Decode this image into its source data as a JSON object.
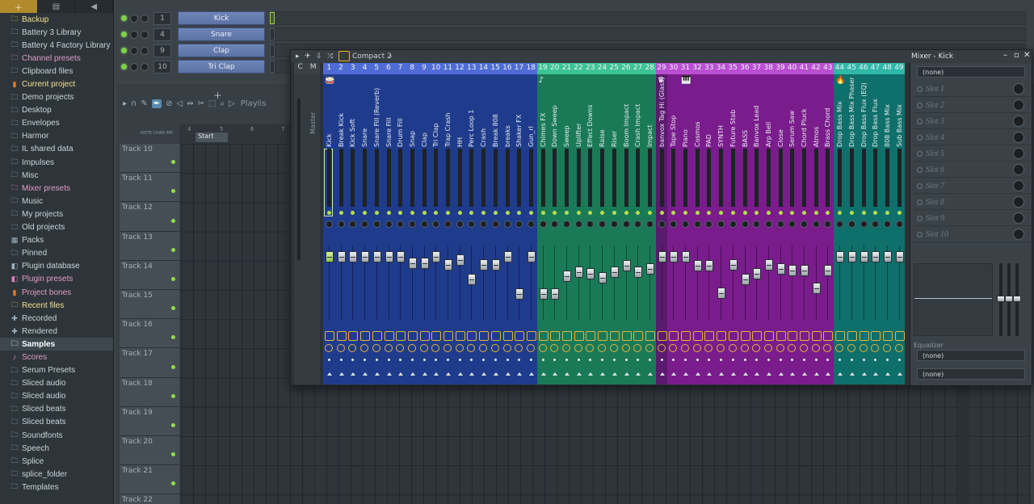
{
  "browser": {
    "tab_icons": [
      "add-icon",
      "file-icon",
      "speaker-icon"
    ],
    "items": [
      {
        "label": "Backup",
        "color": "yellow",
        "icon": "folder-icon"
      },
      {
        "label": "Battery 3 Library",
        "color": "normal",
        "icon": "folder-icon"
      },
      {
        "label": "Battery 4 Factory Library",
        "color": "normal",
        "icon": "folder-icon"
      },
      {
        "label": "Channel presets",
        "color": "pink",
        "icon": "folder-icon"
      },
      {
        "label": "Clipboard files",
        "color": "normal",
        "icon": "folder-icon"
      },
      {
        "label": "Current project",
        "color": "yellow",
        "icon": "project-icon"
      },
      {
        "label": "Demo projects",
        "color": "normal",
        "icon": "folder-icon"
      },
      {
        "label": "Desktop",
        "color": "normal",
        "icon": "folder-icon"
      },
      {
        "label": "Envelopes",
        "color": "normal",
        "icon": "folder-icon"
      },
      {
        "label": "Harmor",
        "color": "normal",
        "icon": "folder-icon"
      },
      {
        "label": "IL shared data",
        "color": "normal",
        "icon": "folder-icon"
      },
      {
        "label": "Impulses",
        "color": "normal",
        "icon": "folder-icon"
      },
      {
        "label": "Misc",
        "color": "normal",
        "icon": "folder-icon"
      },
      {
        "label": "Mixer presets",
        "color": "pink",
        "icon": "folder-icon"
      },
      {
        "label": "Music",
        "color": "normal",
        "icon": "folder-icon"
      },
      {
        "label": "My projects",
        "color": "normal",
        "icon": "folder-icon"
      },
      {
        "label": "Old projects",
        "color": "normal",
        "icon": "folder-icon"
      },
      {
        "label": "Packs",
        "color": "normal",
        "icon": "packs-icon"
      },
      {
        "label": "Pinned",
        "color": "normal",
        "icon": "folder-icon"
      },
      {
        "label": "Plugin database",
        "color": "normal",
        "icon": "plugin-icon"
      },
      {
        "label": "Plugin presets",
        "color": "pink",
        "icon": "plugin-icon"
      },
      {
        "label": "Project bones",
        "color": "pink",
        "icon": "project-icon"
      },
      {
        "label": "Recent files",
        "color": "yellow",
        "icon": "folder-icon"
      },
      {
        "label": "Recorded",
        "color": "normal",
        "icon": "plus-icon"
      },
      {
        "label": "Rendered",
        "color": "normal",
        "icon": "plus-icon"
      },
      {
        "label": "Samples",
        "color": "selected",
        "icon": "folder-icon"
      },
      {
        "label": "Scores",
        "color": "pink",
        "icon": "note-icon"
      },
      {
        "label": "Serum Presets",
        "color": "normal",
        "icon": "folder-icon"
      },
      {
        "label": "Sliced audio",
        "color": "normal",
        "icon": "folder-icon"
      },
      {
        "label": "Sliced audio",
        "color": "normal",
        "icon": "folder-icon"
      },
      {
        "label": "Sliced beats",
        "color": "normal",
        "icon": "folder-icon"
      },
      {
        "label": "Sliced beats",
        "color": "normal",
        "icon": "folder-icon"
      },
      {
        "label": "Soundfonts",
        "color": "normal",
        "icon": "folder-icon"
      },
      {
        "label": "Speech",
        "color": "normal",
        "icon": "folder-icon"
      },
      {
        "label": "Splice",
        "color": "normal",
        "icon": "folder-icon"
      },
      {
        "label": "splice_folder",
        "color": "normal",
        "icon": "folder-icon"
      },
      {
        "label": "Templates",
        "color": "normal",
        "icon": "folder-icon"
      }
    ]
  },
  "channel_rack": {
    "channels": [
      {
        "num": "1",
        "name": "Kick"
      },
      {
        "num": "4",
        "name": "Snare"
      },
      {
        "num": "9",
        "name": "Clap"
      },
      {
        "num": "10",
        "name": "Tri Clap"
      }
    ]
  },
  "playlist": {
    "title": "Playlis",
    "ruler_ticks": [
      "4",
      "5",
      "6",
      "7"
    ],
    "start_marker": "Start",
    "mode_labels": [
      "NOTE",
      "CHAN",
      "PAT"
    ],
    "tracks": [
      "Track 10",
      "Track 11",
      "Track 12",
      "Track 13",
      "Track 14",
      "Track 15",
      "Track 16",
      "Track 17",
      "Track 18",
      "Track 19",
      "Track 20",
      "Track 21",
      "Track 22"
    ]
  },
  "mixer": {
    "preset_name": "Compact 2",
    "window_title": "Mixer - Kick",
    "master_header": [
      "C",
      "M"
    ],
    "master_label": "Master",
    "selected_insert": 1,
    "group_colors": {
      "blue": "#1f3b8c",
      "blue_bar": "#4f6cd6",
      "green": "#1a7a58",
      "green_bar": "#3cc495",
      "purple": "#5a1a6e",
      "magenta": "#7a1c8c",
      "purple_bar": "#b94fd0",
      "teal": "#0f6f6a",
      "teal_bar": "#2fb7a8"
    },
    "group_icons": [
      {
        "name": "drum-icon",
        "glyph": "🥁"
      },
      {
        "name": "note-icon",
        "glyph": "♪"
      },
      {
        "name": "crown-icon",
        "glyph": "♛"
      },
      {
        "name": "piano-icon",
        "glyph": "🎹"
      },
      {
        "name": "fire-icon",
        "glyph": "🔥"
      }
    ],
    "inserts": [
      {
        "num": "1",
        "name": "Kick",
        "group": "blue",
        "fader": 0.92
      },
      {
        "num": "2",
        "name": "Break Kick",
        "group": "blue",
        "fader": 0.92
      },
      {
        "num": "3",
        "name": "Kick Soft",
        "group": "blue",
        "fader": 0.92
      },
      {
        "num": "4",
        "name": "Snare",
        "group": "blue",
        "fader": 0.92
      },
      {
        "num": "5",
        "name": "Snare Fill (Reverb)",
        "group": "blue",
        "fader": 0.92
      },
      {
        "num": "6",
        "name": "Snare Fill",
        "group": "blue",
        "fader": 0.92
      },
      {
        "num": "7",
        "name": "Drum Fill",
        "group": "blue",
        "fader": 0.92
      },
      {
        "num": "8",
        "name": "Snap",
        "group": "blue",
        "fader": 0.84
      },
      {
        "num": "9",
        "name": "Clap",
        "group": "blue",
        "fader": 0.84
      },
      {
        "num": "10",
        "name": "Tri Clap",
        "group": "blue",
        "fader": 0.92
      },
      {
        "num": "11",
        "name": "Trap Crash",
        "group": "blue",
        "fader": 0.82
      },
      {
        "num": "12",
        "name": "HH",
        "group": "blue",
        "fader": 0.88
      },
      {
        "num": "13",
        "name": "Perc Loop 1",
        "group": "blue",
        "fader": 0.62
      },
      {
        "num": "14",
        "name": "Crash",
        "group": "blue",
        "fader": 0.82
      },
      {
        "num": "15",
        "name": "Break 808",
        "group": "blue",
        "fader": 0.82
      },
      {
        "num": "16",
        "name": "breaks",
        "group": "blue",
        "fader": 0.92
      },
      {
        "num": "17",
        "name": "Shaker FX",
        "group": "blue",
        "fader": 0.42
      },
      {
        "num": "18",
        "name": "Gun_rl",
        "group": "blue",
        "fader": 0.92
      },
      {
        "num": "19",
        "name": "Chimes FX",
        "group": "green",
        "fader": 0.42
      },
      {
        "num": "20",
        "name": "Down Sweep",
        "group": "green",
        "fader": 0.42
      },
      {
        "num": "21",
        "name": "Sweep",
        "group": "green",
        "fader": 0.66
      },
      {
        "num": "22",
        "name": "Uplifter",
        "group": "green",
        "fader": 0.72
      },
      {
        "num": "23",
        "name": "Effect Downs",
        "group": "green",
        "fader": 0.7
      },
      {
        "num": "24",
        "name": "Raise",
        "group": "green",
        "fader": 0.64
      },
      {
        "num": "25",
        "name": "Riser",
        "group": "green",
        "fader": 0.72
      },
      {
        "num": "26",
        "name": "Boom Impact",
        "group": "green",
        "fader": 0.8
      },
      {
        "num": "27",
        "name": "Crash Impact",
        "group": "green",
        "fader": 0.72
      },
      {
        "num": "28",
        "name": "Impact",
        "group": "green",
        "fader": 0.76
      },
      {
        "num": "29",
        "name": "banvox Tag Hi (Glass)",
        "group": "purple",
        "fader": 0.92
      },
      {
        "num": "30",
        "name": "Tape Stop",
        "group": "magenta",
        "fader": 0.92
      },
      {
        "num": "31",
        "name": "Piano",
        "group": "magenta",
        "fader": 0.92
      },
      {
        "num": "32",
        "name": "Cosmos",
        "group": "magenta",
        "fader": 0.8
      },
      {
        "num": "33",
        "name": "PAD",
        "group": "magenta",
        "fader": 0.8
      },
      {
        "num": "34",
        "name": "SYNTH",
        "group": "magenta",
        "fader": 0.44
      },
      {
        "num": "35",
        "name": "Future Stab",
        "group": "magenta",
        "fader": 0.82
      },
      {
        "num": "36",
        "name": "BASS",
        "group": "magenta",
        "fader": 0.62
      },
      {
        "num": "37",
        "name": "Banvox Lead",
        "group": "magenta",
        "fader": 0.7
      },
      {
        "num": "38",
        "name": "Arp Bell",
        "group": "magenta",
        "fader": 0.82
      },
      {
        "num": "39",
        "name": "Close",
        "group": "magenta",
        "fader": 0.76
      },
      {
        "num": "40",
        "name": "Serum Saw",
        "group": "magenta",
        "fader": 0.74
      },
      {
        "num": "41",
        "name": "Chord Pluck",
        "group": "magenta",
        "fader": 0.74
      },
      {
        "num": "42",
        "name": "Atmos",
        "group": "magenta",
        "fader": 0.5
      },
      {
        "num": "43",
        "name": "Brass Chord",
        "group": "magenta",
        "fader": 0.74
      },
      {
        "num": "44",
        "name": "Drop Bass Mix",
        "group": "teal",
        "fader": 0.92
      },
      {
        "num": "45",
        "name": "Drop Bass Mix Phaser",
        "group": "teal",
        "fader": 0.92
      },
      {
        "num": "46",
        "name": "Drop Bass Flux (EQ)",
        "group": "teal",
        "fader": 0.92
      },
      {
        "num": "47",
        "name": "Drop Bass Flux",
        "group": "teal",
        "fader": 0.92
      },
      {
        "num": "48",
        "name": "808 Bass Mix",
        "group": "teal",
        "fader": 0.92
      },
      {
        "num": "49",
        "name": "Sub Bass Mix",
        "group": "teal",
        "fader": 0.92
      }
    ]
  },
  "mixer_panel": {
    "input": "(none)",
    "slots": [
      "Slot 1",
      "Slot 2",
      "Slot 3",
      "Slot 4",
      "Slot 5",
      "Slot 6",
      "Slot 7",
      "Slot 8",
      "Slot 9",
      "Slot 10"
    ],
    "eq_label": "Equalizer",
    "output_1": "(none)",
    "output_2": "(none)"
  }
}
